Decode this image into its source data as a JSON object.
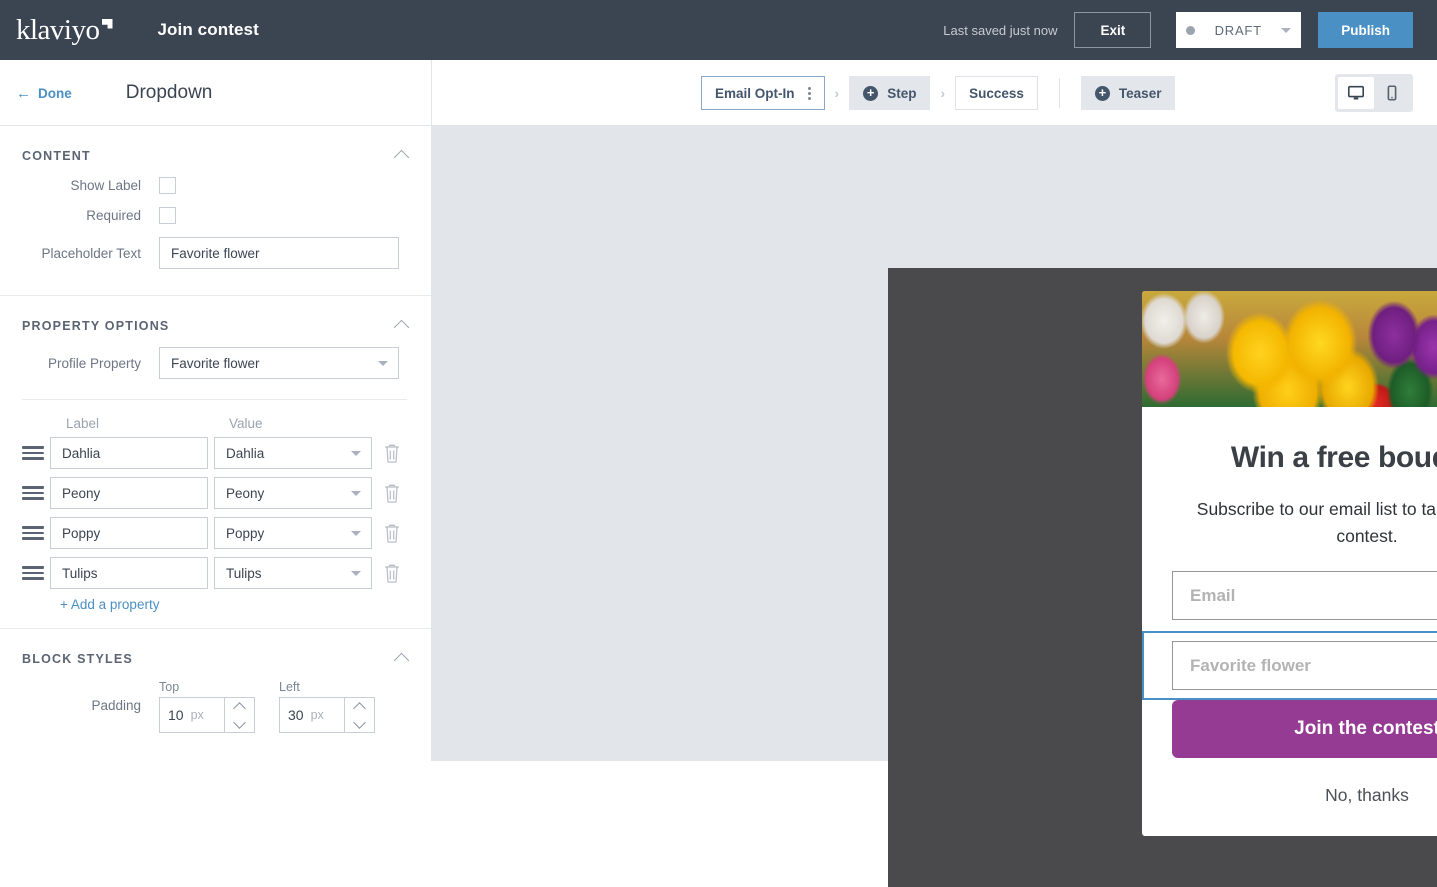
{
  "topbar": {
    "brand": "klaviyo",
    "form_title": "Join contest",
    "saved_text": "Last saved just now",
    "exit_label": "Exit",
    "status_label": "DRAFT",
    "publish_label": "Publish"
  },
  "subbar": {
    "done_label": "Done",
    "back_arrow": "←",
    "panel_heading": "Dropdown",
    "steps": [
      {
        "label": "Email Opt-In",
        "style": "active",
        "has_kebab": true,
        "has_plus": false
      },
      {
        "label": "Step",
        "style": "filled",
        "has_kebab": false,
        "has_plus": true
      },
      {
        "label": "Success",
        "style": "plain",
        "has_kebab": false,
        "has_plus": false
      },
      {
        "label": "Teaser",
        "style": "filled",
        "has_kebab": false,
        "has_plus": true
      }
    ],
    "chevron": "›",
    "devices": [
      {
        "name": "desktop",
        "active": true
      },
      {
        "name": "mobile",
        "active": false
      }
    ]
  },
  "panel": {
    "content": {
      "title": "CONTENT",
      "show_label_label": "Show Label",
      "show_label_checked": false,
      "required_label": "Required",
      "required_checked": false,
      "placeholder_text_label": "Placeholder Text",
      "placeholder_text_value": "Favorite flower"
    },
    "property_options": {
      "title": "PROPERTY OPTIONS",
      "profile_property_label": "Profile Property",
      "profile_property_value": "Favorite flower",
      "col_label": "Label",
      "col_value": "Value",
      "rows": [
        {
          "label": "Dahlia",
          "value": "Dahlia"
        },
        {
          "label": "Peony",
          "value": "Peony"
        },
        {
          "label": "Poppy",
          "value": "Poppy"
        },
        {
          "label": "Tulips",
          "value": "Tulips"
        }
      ],
      "add_property_label": "+ Add a property"
    },
    "block_styles": {
      "title": "BLOCK STYLES",
      "padding_label": "Padding",
      "top_caption": "Top",
      "top_value": "10",
      "top_unit": "px",
      "left_caption": "Left",
      "left_value": "30",
      "left_unit": "px"
    }
  },
  "popup": {
    "close_glyph": "✕",
    "heading": "Win a free bouquet!",
    "subheading": "Subscribe to our email list to take part in the contest.",
    "email_placeholder": "Email",
    "dropdown_placeholder": "Favorite flower",
    "cta_label": "Join the contest",
    "decline_label": "No, thanks"
  },
  "colors": {
    "topbar_bg": "#3b4552",
    "accent_blue": "#4a90c4",
    "cta_purple": "#963b94",
    "canvas_overlay": "#4a4a4d"
  }
}
